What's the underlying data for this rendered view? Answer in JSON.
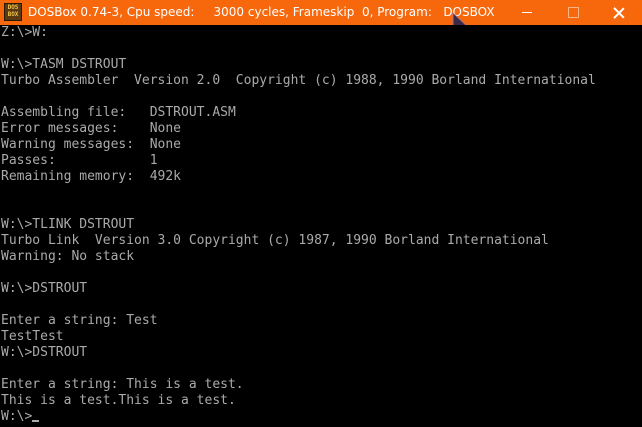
{
  "window": {
    "title": "DOSBox 0.74-3, Cpu speed:     3000 cycles, Frameskip  0, Program:   DOSBOX",
    "icon_text_top": "DOS",
    "icon_text_bottom": "BOX",
    "titlebar_color": "#f7680d",
    "icons": [
      "dosbox-app-icon",
      "minimize-icon",
      "maximize-icon",
      "close-icon",
      "mouse-cursor-icon"
    ]
  },
  "console": {
    "text_color": "#aaaaaa",
    "background": "#000000",
    "lines": [
      "Z:\\>W:",
      "",
      "W:\\>TASM DSTROUT",
      "Turbo Assembler  Version 2.0  Copyright (c) 1988, 1990 Borland International",
      "",
      "Assembling file:   DSTROUT.ASM",
      "Error messages:    None",
      "Warning messages:  None",
      "Passes:            1",
      "Remaining memory:  492k",
      "",
      "",
      "W:\\>TLINK DSTROUT",
      "Turbo Link  Version 3.0 Copyright (c) 1987, 1990 Borland International",
      "Warning: No stack",
      "",
      "W:\\>DSTROUT",
      "",
      "Enter a string: Test",
      "TestTest",
      "W:\\>DSTROUT",
      "",
      "Enter a string: This is a test.",
      "This is a test.This is a test.",
      "W:\\>"
    ]
  }
}
